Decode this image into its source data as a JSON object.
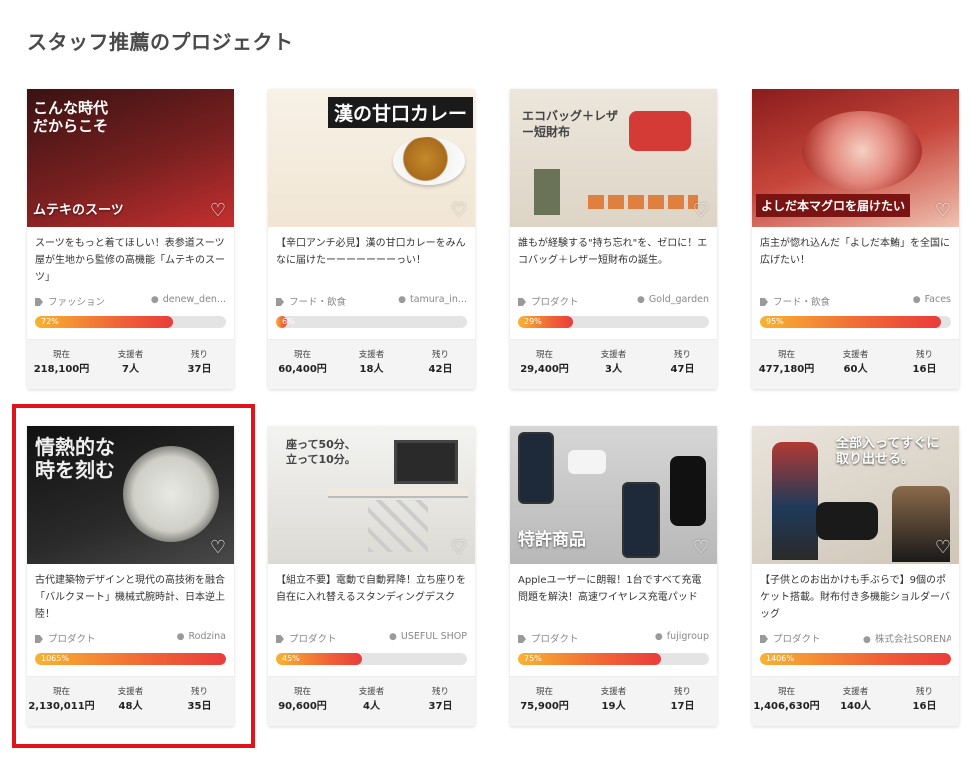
{
  "section_title": "スタッフ推薦のプロジェクト",
  "labels": {
    "current": "現在",
    "backers": "支援者",
    "remaining": "残り"
  },
  "colors": {
    "progress_start": "#f7b332",
    "progress_end": "#ea3c3c",
    "highlight": "#e0121a"
  },
  "projects": [
    {
      "thumb_caption": "ムテキのスーツ",
      "description": "スーツをもっと着てほしい！表参道スーツ屋が生地から監修の高機能「ムテキのスーツ」",
      "category": "ファッション",
      "owner": "denew_den...",
      "progress_label": "72%",
      "progress": 0.72,
      "current": "218,100円",
      "backers": "7人",
      "remaining": "37日"
    },
    {
      "thumb_caption": "漢の甘口カレー",
      "description": "【辛口アンチ必見】漢の甘口カレーをみんなに届けたーーーーーーーっい！",
      "category": "フード・飲食",
      "owner": "tamura_in...",
      "progress_label": "6%",
      "progress": 0.06,
      "current": "60,400円",
      "backers": "18人",
      "remaining": "42日"
    },
    {
      "thumb_caption": "エコバッグ＋レザー短財布",
      "description": "誰もが経験する\"持ち忘れ\"を、ゼロに！エコバッグ＋レザー短財布の誕生。",
      "category": "プロダクト",
      "owner": "Gold_garden",
      "progress_label": "29%",
      "progress": 0.29,
      "current": "29,400円",
      "backers": "3人",
      "remaining": "47日"
    },
    {
      "thumb_caption": "よしだ本マグロを届けたい",
      "description": "店主が惚れ込んだ「よしだ本鮪」を全国に広げたい！",
      "category": "フード・飲食",
      "owner": "Faces",
      "progress_label": "95%",
      "progress": 0.95,
      "current": "477,180円",
      "backers": "60人",
      "remaining": "16日"
    },
    {
      "thumb_caption": "情熱的な時を刻む",
      "description": "古代建築物デザインと現代の高技術を融合「バルクヌート」機械式腕時計、日本逆上陸！",
      "category": "プロダクト",
      "owner": "Rodzina",
      "progress_label": "1065%",
      "progress": 1.0,
      "current": "2,130,011円",
      "backers": "48人",
      "remaining": "35日"
    },
    {
      "thumb_caption": "座って50分、立って10分。",
      "description": "【組立不要】電動で自動昇降！立ち座りを自在に入れ替えるスタンディングデスク",
      "category": "プロダクト",
      "owner": "USEFUL SHOP",
      "progress_label": "45%",
      "progress": 0.45,
      "current": "90,600円",
      "backers": "4人",
      "remaining": "37日"
    },
    {
      "thumb_caption": "特許商品",
      "description": "Appleユーザーに朗報！1台ですべて充電問題を解決！高速ワイヤレス充電パッド",
      "category": "プロダクト",
      "owner": "fujigroup",
      "progress_label": "75%",
      "progress": 0.75,
      "current": "75,900円",
      "backers": "19人",
      "remaining": "17日"
    },
    {
      "thumb_caption": "全部入ってすぐに取り出せる。",
      "description": "【子供とのお出かけも手ぶらで】9個のポケット搭載。財布付き多機能ショルダーバッグ",
      "category": "プロダクト",
      "owner": "株式会社SORENA",
      "progress_label": "1406%",
      "progress": 1.0,
      "current": "1,406,630円",
      "backers": "140人",
      "remaining": "16日"
    }
  ]
}
